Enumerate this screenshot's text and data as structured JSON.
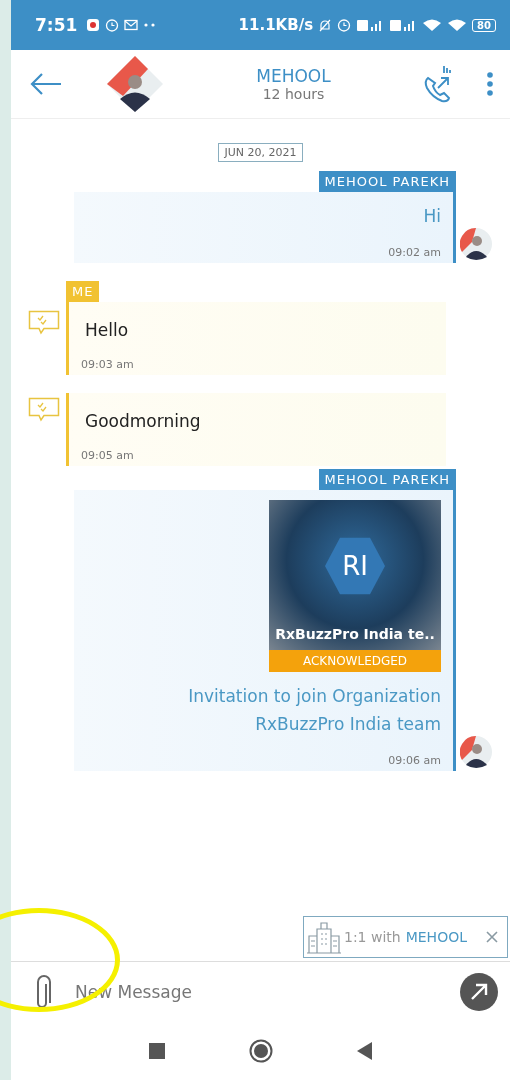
{
  "status_bar": {
    "time": "7:51",
    "speed": "11.1KB/s",
    "battery": "80"
  },
  "header": {
    "title": "MEHOOL",
    "subtitle": "12 hours"
  },
  "date_chip": "JUN 20, 2021",
  "messages": [
    {
      "kind": "received",
      "sender": "MEHOOL PAREKH",
      "text": "Hi",
      "time": "09:02 am"
    },
    {
      "kind": "sent",
      "sender": "ME",
      "text": "Hello",
      "time": "09:03 am"
    },
    {
      "kind": "sent",
      "text": "Goodmorning",
      "time": "09:05 am"
    },
    {
      "kind": "received",
      "sender": "MEHOOL PAREKH",
      "card": {
        "initials": "RI",
        "title": "RxBuzzPro India te..",
        "status": "ACKNOWLEDGED"
      },
      "text": "Invitation to join Organization RxBuzzPro India team",
      "time": "09:06 am"
    }
  ],
  "context_chip": {
    "prefix": "1:1 with",
    "name": "MEHOOL"
  },
  "composer": {
    "placeholder": "New Message"
  }
}
